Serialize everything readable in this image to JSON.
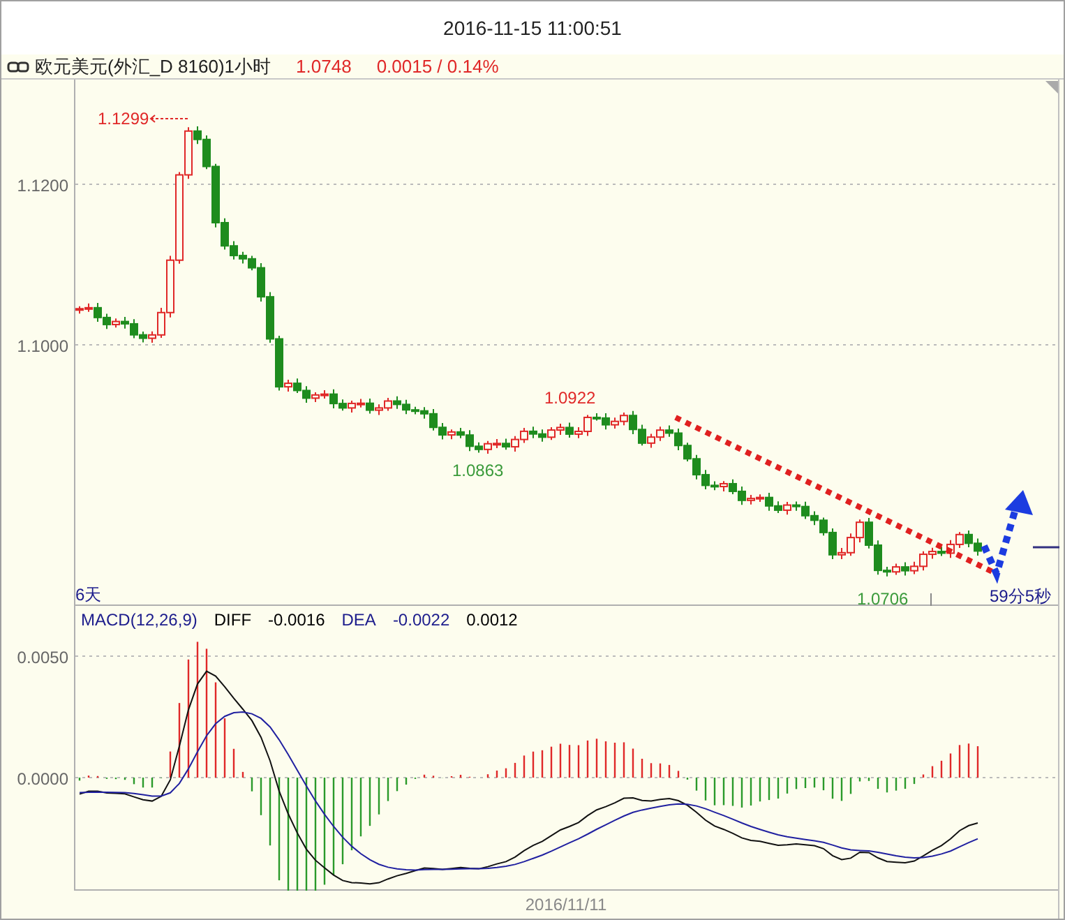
{
  "title_bar": {
    "datetime": "2016-11-15 11:00:51"
  },
  "header": {
    "symbol": "欧元美元(外汇_D 8160)1小时",
    "price": "1.0748",
    "change": "0.0015 / 0.14%"
  },
  "price_chart": {
    "y_axis_labels": [
      "1.1200",
      "1.1000"
    ],
    "annotations": [
      {
        "text": "1.1299",
        "kind": "high"
      },
      {
        "text": "1.0922",
        "kind": "up"
      },
      {
        "text": "1.0863",
        "kind": "down"
      },
      {
        "text": "1.0706",
        "kind": "down"
      }
    ],
    "span_label": "6天",
    "countdown": "59分5秒"
  },
  "macd": {
    "legend": [
      {
        "text": "MACD(12,26,9)",
        "color": "#1c1c8c"
      },
      {
        "text": "DIFF",
        "color": "#000000"
      },
      {
        "text": "-0.0016",
        "color": "#000000"
      },
      {
        "text": "DEA",
        "color": "#1c1c8c"
      },
      {
        "text": "-0.0022",
        "color": "#1c1c8c"
      },
      {
        "text": "0.0012",
        "color": "#000000"
      }
    ],
    "y_axis_labels": [
      "0.0050",
      "0.0000"
    ]
  },
  "x_axis": {
    "date": "2016/11/11"
  }
}
